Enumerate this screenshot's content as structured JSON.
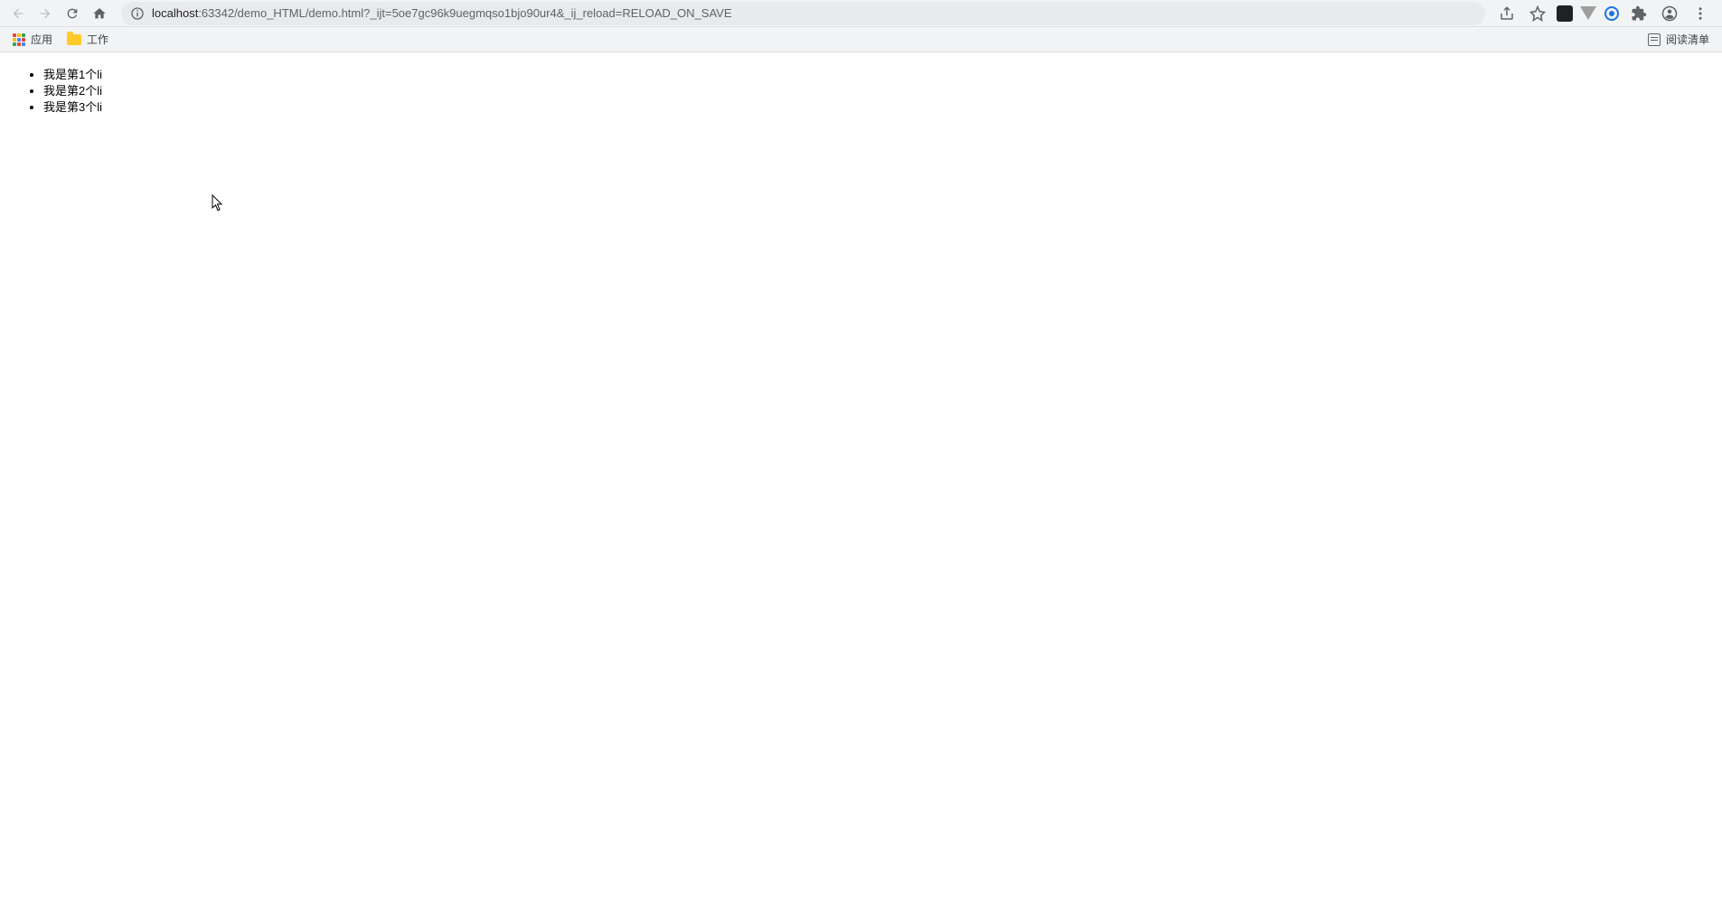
{
  "address": {
    "host": "localhost",
    "port_path": ":63342/demo_HTML/demo.html?_ijt=5oe7gc96k9uegmqso1bjo90ur4&_ij_reload=RELOAD_ON_SAVE"
  },
  "bookmarks": {
    "apps_label": "应用",
    "folder_label": "工作",
    "reading_list_label": "阅读清单"
  },
  "page": {
    "list_items": [
      "我是第1个li",
      "我是第2个li",
      "我是第3个li"
    ]
  }
}
